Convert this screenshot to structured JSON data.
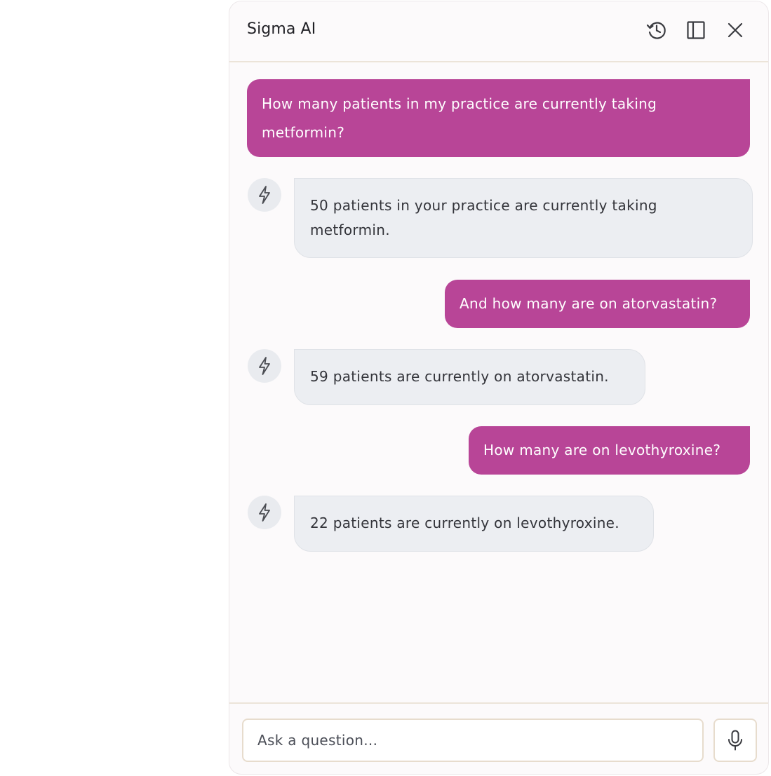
{
  "header": {
    "title": "Sigma AI",
    "icons": [
      "history-icon",
      "sidebar-panel-icon",
      "close-icon"
    ]
  },
  "messages": [
    {
      "role": "user",
      "text": "How many patients in my practice are currently taking metformin?"
    },
    {
      "role": "assistant",
      "text": "50 patients in your practice are currently taking metformin."
    },
    {
      "role": "user",
      "text": "And how many are on atorvastatin?"
    },
    {
      "role": "assistant",
      "text": "59 patients are currently on atorvastatin."
    },
    {
      "role": "user",
      "text": "How many are on levothyroxine?"
    },
    {
      "role": "assistant",
      "text": "22 patients are currently on levothyroxine."
    }
  ],
  "footer": {
    "input_placeholder": "Ask a question...",
    "input_value": "",
    "mic_icon": "microphone-icon"
  },
  "colors": {
    "user_bubble": "#b84597",
    "assistant_bubble": "#eceef2",
    "panel_bg": "#fcfafb"
  }
}
